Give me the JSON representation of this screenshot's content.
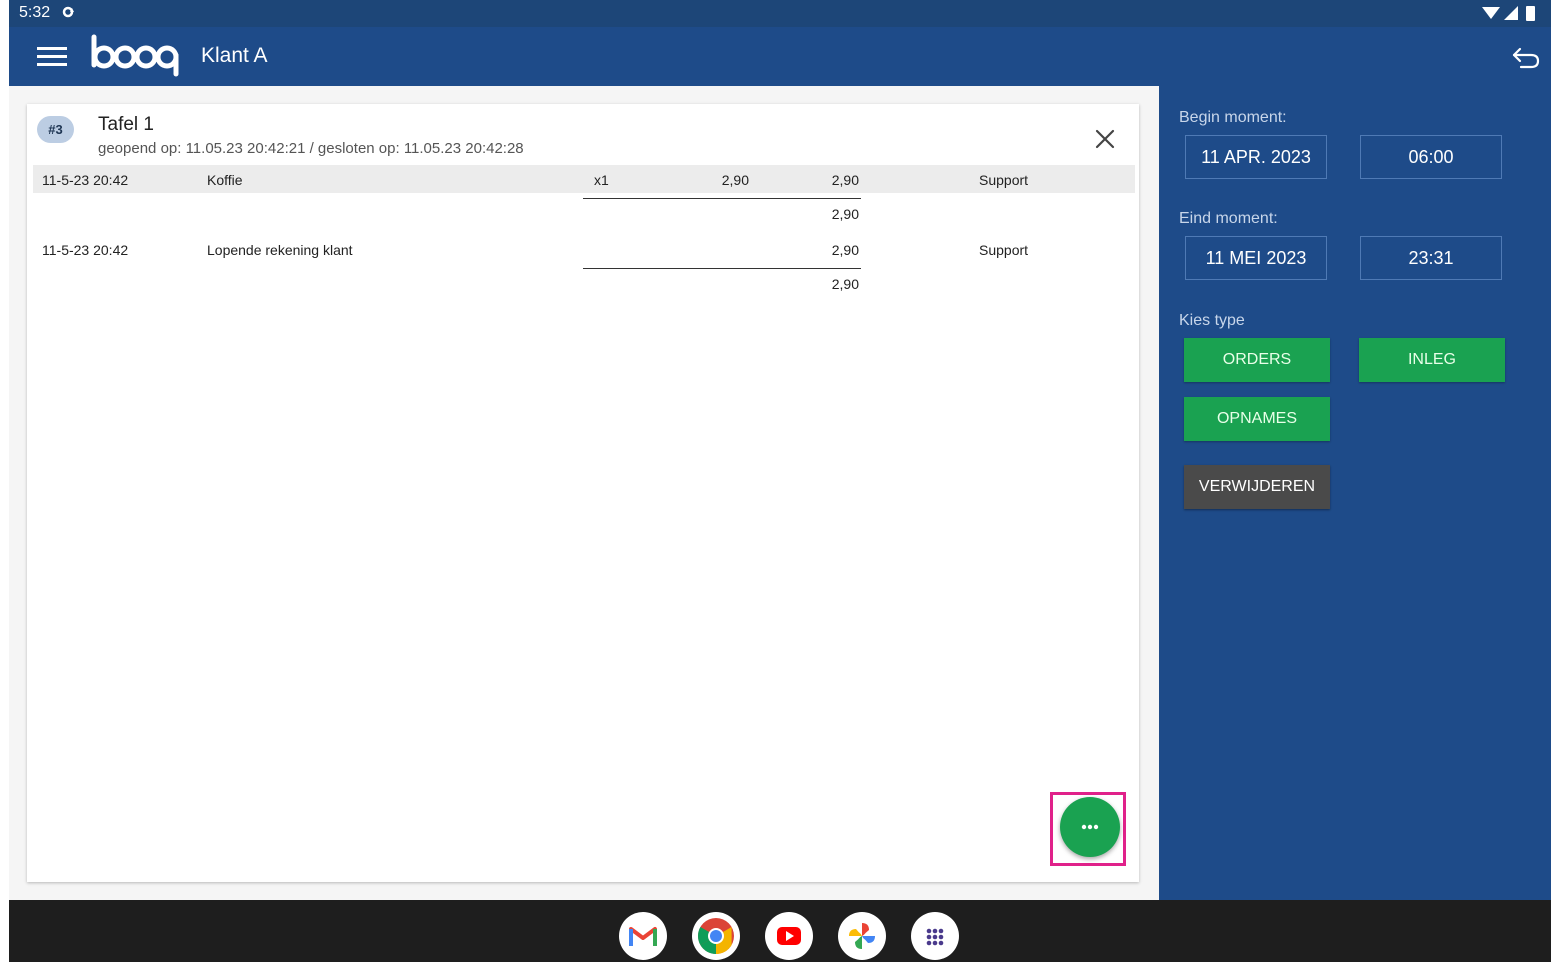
{
  "status_bar": {
    "time": "5:32"
  },
  "app_bar": {
    "title": "Klant A",
    "logo_text": "booq"
  },
  "card": {
    "badge": "#3",
    "title": "Tafel 1",
    "subtitle": "geopend op: 11.05.23 20:42:21 / gesloten op: 11.05.23 20:42:28",
    "rows": [
      {
        "date": "11-5-23 20:42",
        "name": "Koffie",
        "qty": "x1",
        "price": "2,90",
        "total": "2,90",
        "user": "Support"
      },
      {
        "date": "11-5-23 20:42",
        "name": "Lopende rekening klant",
        "qty": "",
        "price": "",
        "total": "2,90",
        "user": "Support"
      }
    ],
    "subtotals": [
      "2,90",
      "2,90"
    ]
  },
  "panel": {
    "begin_label": "Begin moment:",
    "begin_date": "11 APR. 2023",
    "begin_time": "06:00",
    "end_label": "Eind moment:",
    "end_date": "11 MEI 2023",
    "end_time": "23:31",
    "type_label": "Kies type",
    "btn_orders": "ORDERS",
    "btn_inleg": "INLEG",
    "btn_opnames": "OPNAMES",
    "btn_delete": "VERWIJDEREN"
  },
  "dock": {
    "apps": [
      "gmail-icon",
      "chrome-icon",
      "youtube-icon",
      "photos-icon",
      "app-drawer-icon"
    ]
  },
  "colors": {
    "appbar": "#1e4b89",
    "accent_green": "#1aa251",
    "highlight": "#e0218a"
  }
}
